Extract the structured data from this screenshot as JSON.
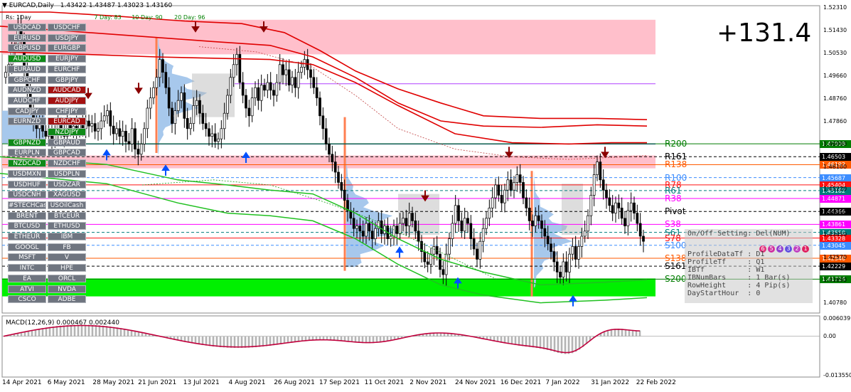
{
  "header": {
    "title": "EURCAD,Daily",
    "ohlc": "1.43422 1.43487 1.43023 1.43160"
  },
  "day_bar": {
    "label": "Rs: 1Day",
    "items": [
      "7 Day: 83",
      "10 Day: 90",
      "20 Day: 96"
    ]
  },
  "profit_label": "+131.4",
  "symbols": [
    [
      "USDCAD",
      "USDCHF"
    ],
    [
      "EURUSD",
      "USDJPY"
    ],
    [
      "GBPUSD",
      "EURGBP"
    ],
    [
      "AUDUSD",
      "EURJPY"
    ],
    [
      "EURAUD",
      "EURCHF"
    ],
    [
      "GBPCHF",
      "GBPJPY"
    ],
    [
      "AUDNZD",
      "AUDCAD"
    ],
    [
      "AUDCHF",
      "AUDJPY"
    ],
    [
      "CADJPY",
      "CHFJPY"
    ],
    [
      "EURNZD",
      "EURCAD"
    ],
    [
      "",
      "NZDJPY"
    ],
    [
      "GBPNZD",
      "GBPAUD"
    ],
    [
      "EURPLN",
      "GBPCAD"
    ],
    [
      "NZDCAD",
      "NZDCHF"
    ],
    [
      "USDMXN",
      "USDPLN"
    ],
    [
      "USDHUF",
      "USDZAR"
    ],
    [
      "USDCNH",
      "XAGUSD"
    ],
    [
      "#STECHCash",
      "USOilCash"
    ],
    [
      "BRENT",
      "BTCEUR"
    ],
    [
      "BTCUSD",
      "ETHUSD"
    ],
    [
      "ETHEUR",
      "IBM"
    ],
    [
      "GOOGL",
      "FB"
    ],
    [
      "MSFT",
      "V"
    ],
    [
      "INTC",
      "HPE"
    ],
    [
      "EA",
      "ORCL"
    ],
    [
      "ATVI",
      "NVDA"
    ],
    [
      "CSCO",
      "ADBE"
    ]
  ],
  "symbol_colors": {
    "AUDUSD": "g",
    "GBPNZD": "g",
    "NZDCAD": "g",
    "AUDCAD": "r",
    "AUDJPY": "r",
    "EURCAD": "r",
    "NZDJPY": "g"
  },
  "pivots": [
    {
      "label": "R200",
      "color": "#007c00",
      "price": 1.47008
    },
    {
      "label": "R161",
      "color": "#000000",
      "price": 1.46503
    },
    {
      "label": "R138",
      "color": "#ff5a00",
      "price": 1.46192
    },
    {
      "label": "R100",
      "color": "#3c8dff",
      "price": 1.45687
    },
    {
      "label": "R78",
      "color": "#ff1010",
      "price": 1.45404
    },
    {
      "label": "R61",
      "color": "#007c7c",
      "price": 1.45182
    },
    {
      "label": "R38",
      "color": "#ff00ff",
      "price": 1.44871
    },
    {
      "label": "Pivot",
      "color": "#000000",
      "price": 1.44366
    },
    {
      "label": "S38",
      "color": "#ff00ff",
      "price": 1.43861
    },
    {
      "label": "S61",
      "color": "#007c7c",
      "price": 1.4355
    },
    {
      "label": "S78",
      "color": "#ff1010",
      "price": 1.43328
    },
    {
      "label": "S100",
      "color": "#3c8dff",
      "price": 1.43045
    },
    {
      "label": "S138",
      "color": "#ff5a00",
      "price": 1.4254
    },
    {
      "label": "S161",
      "color": "#000000",
      "price": 1.42229
    },
    {
      "label": "S200",
      "color": "#007c00",
      "price": 1.41724
    }
  ],
  "price_tags": [
    {
      "text": "1.47008",
      "bg": "#007c00",
      "price": 1.47008
    },
    {
      "text": "1.46503",
      "bg": "#000000",
      "price": 1.46503
    },
    {
      "text": "1.46192",
      "bg": "#ff5a00",
      "price": 1.46192
    },
    {
      "text": "1.45687",
      "bg": "#3c8dff",
      "price": 1.45687
    },
    {
      "text": "1.45404",
      "bg": "#ff1010",
      "price": 1.45404
    },
    {
      "text": "1.45182",
      "bg": "#007c7c",
      "price": 1.45182
    },
    {
      "text": "1.44871",
      "bg": "#ff00ff",
      "price": 1.44871
    },
    {
      "text": "1.44366",
      "bg": "#000000",
      "price": 1.44366
    },
    {
      "text": "1.43861",
      "bg": "#ff00ff",
      "price": 1.43861
    },
    {
      "text": "1.43550",
      "bg": "#007c7c",
      "price": 1.4355
    },
    {
      "text": "1.43328",
      "bg": "#ff1010",
      "price": 1.43328
    },
    {
      "text": "1.43045",
      "bg": "#3c8dff",
      "price": 1.43045
    },
    {
      "text": "1.42540",
      "bg": "#ff5a00",
      "price": 1.4254
    },
    {
      "text": "1.42229",
      "bg": "#000000",
      "price": 1.42229
    },
    {
      "text": "1.41724",
      "bg": "#007c00",
      "price": 1.41724
    }
  ],
  "info_panel": {
    "setting": "On/Off Setting: Del(NUM)",
    "lines": [
      "ProfileDataTf : D1",
      "ProfileTf     : Q1",
      "IBTf          : W1",
      "IBNumBars     : 1 Bar(s)",
      "RowHeight     : 4 Pip(s)",
      "DayStartHour  : 0"
    ],
    "circles": [
      "6",
      "5",
      "4",
      "3",
      "2",
      "1"
    ]
  },
  "chart_data": [
    {
      "type": "candlestick",
      "title": "EURCAD,Daily",
      "ylim": [
        1.404,
        1.524
      ],
      "y_ticks": [
        1.5231,
        1.5143,
        1.5053,
        1.4966,
        1.4876,
        1.4786,
        1.4699,
        1.461,
        1.4522,
        1.4434,
        1.4345,
        1.4257,
        1.4169,
        1.4078
      ],
      "x_ticks": [
        "14 Apr 2021",
        "6 May 2021",
        "28 May 2021",
        "21 Jun 2021",
        "13 Jul 2021",
        "4 Aug 2021",
        "26 Aug 2021",
        "17 Sep 2021",
        "11 Oct 2021",
        "2 Nov 2021",
        "24 Nov 2021",
        "16 Dec 2021",
        "7 Jan 2022",
        "31 Jan 2022",
        "22 Feb 2022"
      ],
      "closes": [
        1.498,
        1.501,
        1.506,
        1.509,
        1.516,
        1.511,
        1.5,
        1.49,
        1.484,
        1.478,
        1.476,
        1.479,
        1.475,
        1.473,
        1.476,
        1.471,
        1.474,
        1.478,
        1.476,
        1.473,
        1.478,
        1.476,
        1.477,
        1.475,
        1.478,
        1.476,
        1.479,
        1.477,
        1.478,
        1.475,
        1.476,
        1.479,
        1.481,
        1.483,
        1.477,
        1.474,
        1.476,
        1.473,
        1.475,
        1.471,
        1.47,
        1.476,
        1.468,
        1.466,
        1.47,
        1.476,
        1.484,
        1.488,
        1.492,
        1.496,
        1.503,
        1.498,
        1.492,
        1.484,
        1.478,
        1.483,
        1.487,
        1.49,
        1.48,
        1.476,
        1.478,
        1.485,
        1.487,
        1.482,
        1.478,
        1.476,
        1.473,
        1.474,
        1.471,
        1.472,
        1.476,
        1.482,
        1.489,
        1.496,
        1.501,
        1.505,
        1.494,
        1.489,
        1.484,
        1.481,
        1.488,
        1.492,
        1.487,
        1.493,
        1.491,
        1.494,
        1.491,
        1.489,
        1.494,
        1.501,
        1.497,
        1.499,
        1.493,
        1.496,
        1.492,
        1.498,
        1.5,
        1.503,
        1.499,
        1.496,
        1.492,
        1.488,
        1.481,
        1.476,
        1.47,
        1.466,
        1.463,
        1.459,
        1.455,
        1.452,
        1.448,
        1.444,
        1.441,
        1.437,
        1.438,
        1.436,
        1.434,
        1.439,
        1.436,
        1.433,
        1.437,
        1.44,
        1.435,
        1.438,
        1.433,
        1.434,
        1.438,
        1.435,
        1.439,
        1.441,
        1.438,
        1.443,
        1.44,
        1.436,
        1.432,
        1.428,
        1.424,
        1.423,
        1.427,
        1.43,
        1.427,
        1.421,
        1.419,
        1.427,
        1.433,
        1.439,
        1.446,
        1.44,
        1.436,
        1.441,
        1.439,
        1.433,
        1.429,
        1.425,
        1.432,
        1.437,
        1.441,
        1.445,
        1.449,
        1.454,
        1.45,
        1.447,
        1.452,
        1.456,
        1.452,
        1.455,
        1.458,
        1.455,
        1.449,
        1.445,
        1.44,
        1.438,
        1.442,
        1.44,
        1.437,
        1.434,
        1.431,
        1.428,
        1.424,
        1.42,
        1.418,
        1.424,
        1.42,
        1.427,
        1.43,
        1.425,
        1.43,
        1.434,
        1.436,
        1.442,
        1.45,
        1.458,
        1.463,
        1.456,
        1.452,
        1.449,
        1.446,
        1.443,
        1.447,
        1.445,
        1.441,
        1.438,
        1.444,
        1.447,
        1.443,
        1.439,
        1.434,
        1.432
      ]
    },
    {
      "type": "bar",
      "title": "MACD(12,26,9) 0.000467 0.002440",
      "ylim": [
        -0.014,
        0.007
      ],
      "y_ticks": [
        0.006039,
        0.0,
        -0.01355
      ]
    }
  ]
}
